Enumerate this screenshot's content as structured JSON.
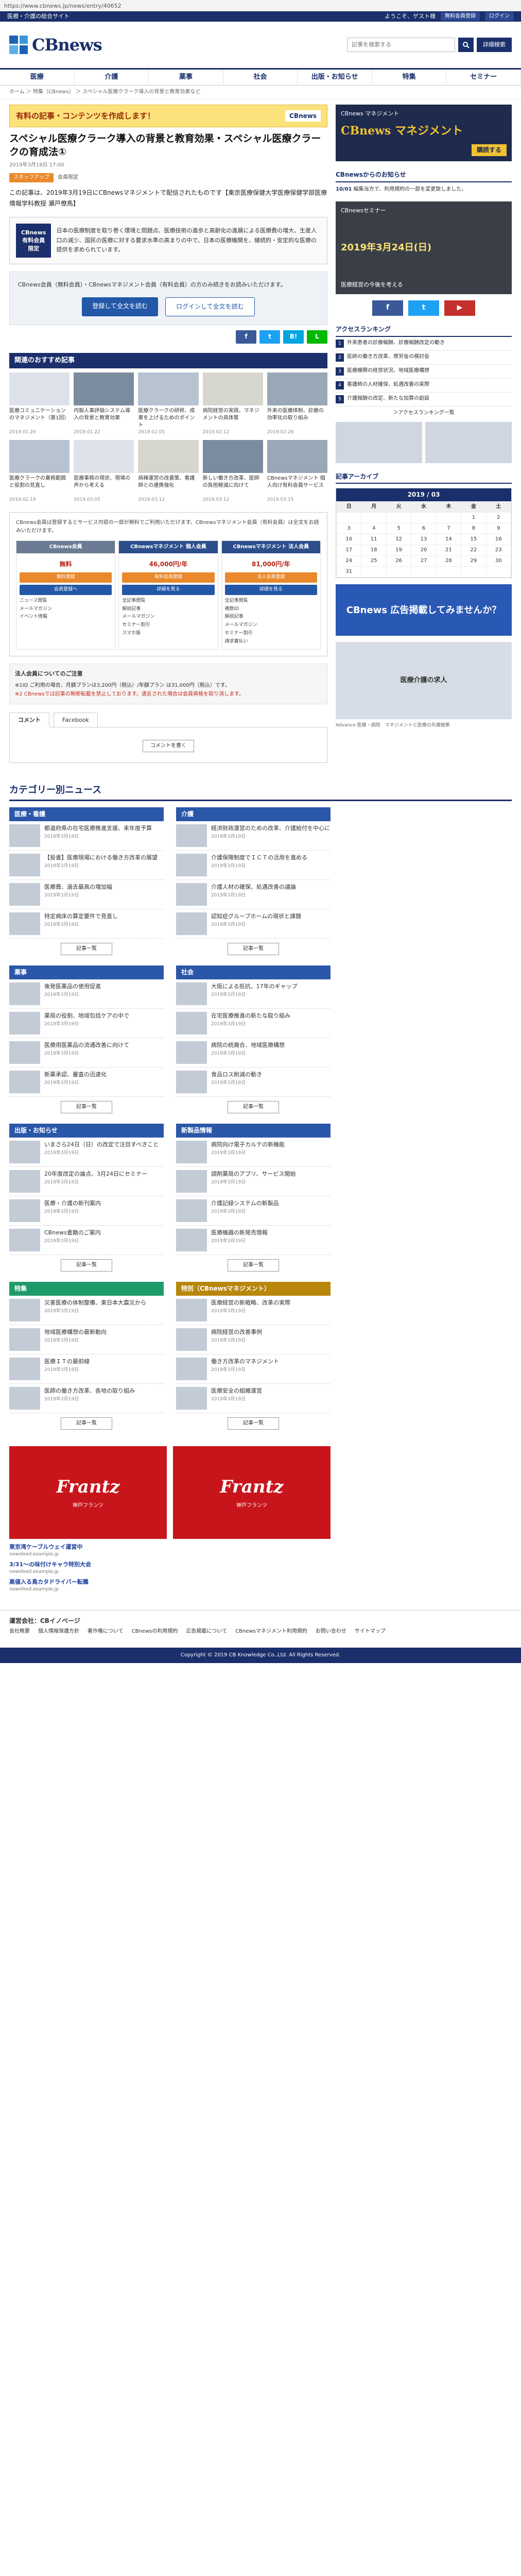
{
  "browser": {
    "url": "https://www.cbnews.jp/news/entry/40652"
  },
  "topbar": {
    "site_tag": "医療・介護の総合サイト",
    "welcome": "ようこそ、ゲスト様",
    "btn_login": "無料会員登録",
    "btn_mypage": "ログイン"
  },
  "header": {
    "logo_text": "CBnews",
    "search_placeholder": "記事を検索する",
    "adv_search": "詳細検索"
  },
  "gnav": [
    "医療",
    "介護",
    "薬事",
    "社会",
    "出版・お知らせ",
    "特集",
    "セミナー"
  ],
  "breadcrumb": "ホーム ＞ 特集（CBnews） ＞ スペシャル医療クラーク導入の背景と教育効果など",
  "premium_banner": {
    "text": "有料の記事・コンテンツを作成します！",
    "brand": "CBnews"
  },
  "article": {
    "title": "スペシャル医療クラーク導入の背景と教育効果・スペシャル医療クラークの育成法①",
    "meta": "2019年3月19日 17:00",
    "tag": "スタッフアップ",
    "tag2": "会員限定",
    "lead": "この記事は、2019年3月19日にCBnewsマネジメントで配信されたものです【東京医療保健大学医療保健学部医療情報学科教授 瀬戸僚馬】"
  },
  "paybox": {
    "badge": "CBnews 有料会員 限定",
    "text": "日本の医療制度を取り巻く環境と問題点、医療技術の進歩と高齢化の進展による医療費の増大、生産人口の減少、国民の医療に対する要求水準の高まりの中で、日本の医療機関を、継続的・安定的な医療の提供を求められています。"
  },
  "loginbox": {
    "text": "CBnews会員（無料会員）・CBnewsマネジメント会員（有料会員）の方のみ続きをお読みいただけます。",
    "btn_register": "登録して全文を読む",
    "btn_login": "ログインして全文を読む"
  },
  "social_share": [
    "f",
    "t",
    "B!",
    "L"
  ],
  "recommend": {
    "title": "関連のおすすめ記事",
    "items": [
      {
        "title": "医療コミュニケーションのマネジメント（第1回）",
        "date": "2019.01.29"
      },
      {
        "title": "内製人事評価システム導入の背景と教育効果",
        "date": "2019.01.22"
      },
      {
        "title": "医療クラークの研修、成果を上げるためのポイント",
        "date": "2019.02.05"
      },
      {
        "title": "病院経営の実践、マネジメントの具体策",
        "date": "2019.02.12"
      },
      {
        "title": "外来の医療体制、診療の効率化の取り組み",
        "date": "2019.02.26"
      },
      {
        "title": "医療クラークの業務範囲と役割の見直し",
        "date": "2019.02.19"
      },
      {
        "title": "医療事務の現状、現場の声から考える",
        "date": "2019.03.05"
      },
      {
        "title": "病棟運営の改善策、看護師との連携強化",
        "date": "2019.03.12"
      },
      {
        "title": "新しい働き方改革、医師の負担軽減に向けて",
        "date": "2019.03.12"
      },
      {
        "title": "CBnewsマネジメント 個人向け有料会員サービス",
        "date": "2019.03.15"
      }
    ]
  },
  "plans": {
    "intro": "CBnews会員は登録するとサービス内容の一部が無料でご利用いただけます。CBnewsマネジメント会員（有料会員）は全文をお読みいただけます。",
    "columns": [
      {
        "name": "CBnews会員",
        "price": "無料",
        "btn1": "無料登録",
        "btn2": "会員登録へ",
        "features": [
          "ニュース閲覧",
          "メールマガジン",
          "イベント情報"
        ]
      },
      {
        "name": "CBnewsマネジメント 個人会員",
        "price": "46,000円/年",
        "btn1": "有料会員登録",
        "btn2": "詳細を見る",
        "features": [
          "全記事閲覧",
          "解説記事",
          "メールマガジン",
          "セミナー割引",
          "スマホ版"
        ]
      },
      {
        "name": "CBnewsマネジメント 法人会員",
        "price": "81,000円/年",
        "btn1": "法人会員登録",
        "btn2": "詳細を見る",
        "features": [
          "全記事閲覧",
          "複数ID",
          "解説記事",
          "メールマガジン",
          "セミナー割引",
          "請求書払い"
        ]
      }
    ]
  },
  "priceinfo": {
    "title": "法人会員についてのご注意",
    "text": "※1ID ご利用の場合、月額プランは3,200円（税込）/年額プラン は31,000円（税込）です。",
    "note": "※2 CBnewsでは記事の無断転載を禁止しております。違反された場合は会員資格を取り消します。"
  },
  "comments": {
    "tab1": "コメント",
    "tab2": "Facebook",
    "button": "コメントを書く"
  },
  "category_heading": "カテゴリー別ニュース",
  "categories": [
    {
      "name": "医療・看護",
      "color": "#2b57a8",
      "items": [
        {
          "t": "都道府県の在宅医療推進支援、来年度予算",
          "d": "2019年3月19日"
        },
        {
          "t": "【投書】医療現場における働き方改革の展望",
          "d": "2019年3月19日"
        },
        {
          "t": "医療費、過去最高の増加幅",
          "d": "2019年3月19日"
        },
        {
          "t": "特定病床の算定要件で見直し",
          "d": "2019年3月19日"
        }
      ]
    },
    {
      "name": "介護",
      "color": "#2b57a8",
      "items": [
        {
          "t": "経済財政運営のための改革、介護給付を中心に",
          "d": "2019年3月19日"
        },
        {
          "t": "介護保険制度でＩＣＴの活用を進める",
          "d": "2019年3月19日"
        },
        {
          "t": "介護人材の確保、処遇改善の議論",
          "d": "2019年3月19日"
        },
        {
          "t": "認知症グループホームの現状と課題",
          "d": "2019年3月19日"
        }
      ]
    },
    {
      "name": "薬事",
      "color": "#2b57a8",
      "items": [
        {
          "t": "後発医薬品の使用促進",
          "d": "2019年3月19日"
        },
        {
          "t": "薬局の役割、地域包括ケアの中で",
          "d": "2019年3月19日"
        },
        {
          "t": "医療用医薬品の流通改善に向けて",
          "d": "2019年3月19日"
        },
        {
          "t": "新薬承認、審査の迅速化",
          "d": "2019年3月19日"
        }
      ]
    },
    {
      "name": "社会",
      "color": "#2b57a8",
      "items": [
        {
          "t": "大阪による抵抗、17年のギャップ",
          "d": "2019年3月19日"
        },
        {
          "t": "在宅医療推進の新たな取り組み",
          "d": "2019年3月19日"
        },
        {
          "t": "病院の統廃合、地域医療構想",
          "d": "2019年3月19日"
        },
        {
          "t": "食品ロス削減の動き",
          "d": "2019年3月19日"
        }
      ]
    },
    {
      "name": "出版・お知らせ",
      "color": "#2b57a8",
      "items": [
        {
          "t": "いまさら24日（日）の改定で注目すべきこと",
          "d": "2019年3月19日"
        },
        {
          "t": "20年度改定の論点、3月24日にセミナー",
          "d": "2019年3月19日"
        },
        {
          "t": "医療・介護の新刊案内",
          "d": "2019年3月19日"
        },
        {
          "t": "CBnews書籍のご案内",
          "d": "2019年3月19日"
        }
      ]
    },
    {
      "name": "新製品情報",
      "color": "#2b57a8",
      "items": [
        {
          "t": "病院向け電子カルテの新機能",
          "d": "2019年3月19日"
        },
        {
          "t": "調剤薬局のアプリ、サービス開始",
          "d": "2019年3月19日"
        },
        {
          "t": "介護記録システムの新製品",
          "d": "2019年3月19日"
        },
        {
          "t": "医療機器の新発売情報",
          "d": "2019年3月19日"
        }
      ]
    },
    {
      "name": "特集",
      "color": "#1f9b6a",
      "items": [
        {
          "t": "災害医療の体制整備、東日本大震災から",
          "d": "2019年3月19日"
        },
        {
          "t": "地域医療構想の最新動向",
          "d": "2019年3月19日"
        },
        {
          "t": "医療ＩＴの最前線",
          "d": "2019年3月19日"
        },
        {
          "t": "医師の働き方改革、各地の取り組み",
          "d": "2019年3月19日"
        }
      ]
    },
    {
      "name": "特別（CBnewsマネジメント）",
      "color": "#b8860b",
      "items": [
        {
          "t": "医療経営の新戦略、改革の実際",
          "d": "2019年3月19日"
        },
        {
          "t": "病院経営の改善事例",
          "d": "2019年3月19日"
        },
        {
          "t": "働き方改革のマネジメント",
          "d": "2019年3月19日"
        },
        {
          "t": "医療安全の組織運営",
          "d": "2019年3月19日"
        }
      ]
    }
  ],
  "category_more": "記事一覧",
  "ads_bottom": [
    {
      "big": "Frantz",
      "small": "神戸フランツ"
    },
    {
      "big": "Frantz",
      "small": "神戸フランツ"
    }
  ],
  "admeta": {
    "label": "広告",
    "links": [
      {
        "title": "東京湾ケーブルウェイ運営中",
        "src": "newsfeed.example.jp"
      },
      {
        "title": "3/31〜の味付けキャラ特別大会",
        "src": "newsfeed.example.jp"
      },
      {
        "title": "高値入る鳥カタドライバー転職",
        "src": "newsfeed.example.jp"
      }
    ]
  },
  "footer": {
    "title": "運営会社：CBイノベージ",
    "links": [
      "会社概要",
      "個人情報保護方針",
      "著作権について",
      "CBnewsの利用規約",
      "広告掲載について",
      "CBnewsマネジメント利用規約",
      "お問い合わせ",
      "サイトマップ"
    ],
    "copyright": "Copyright © 2019 CB Knowledge Co.,Ltd. All Rights Reserved."
  },
  "sidebar": {
    "ad_top": {
      "l1": "CBnews マネジメント",
      "l2": "CBnews マネジメント",
      "l3": "購読する"
    },
    "news_head": "CBnewsからのお知らせ",
    "news": [
      {
        "date": "10/01",
        "text": "編集当方で、利用規約の一部を変更致しました。"
      }
    ],
    "seminar": {
      "title": "CBnewsセミナー",
      "date": "2019年3月24日(日)",
      "text": "医療経営の今後を考える"
    },
    "social": [
      "f",
      "t",
      "▶"
    ],
    "rank_head": "アクセスランキング",
    "ranking": [
      "外来患者の診療報酬、診療報酬改定の動き",
      "医師の働き方改革、厚労省の検討会",
      "医療機関の経営状況、地域医療構想",
      "看護師の人材確保、処遇改善の実際",
      "介護報酬の改定、新たな加算の創設"
    ],
    "rank_more": "＞アクセスランキング一覧",
    "calendar": {
      "title": "記事アーカイブ",
      "month": "2019 / 03",
      "weekdays": [
        "日",
        "月",
        "火",
        "水",
        "木",
        "金",
        "土"
      ],
      "weeks": [
        [
          "",
          "",
          "",
          "",
          "",
          "1",
          "2"
        ],
        [
          "3",
          "4",
          "5",
          "6",
          "7",
          "8",
          "9"
        ],
        [
          "10",
          "11",
          "12",
          "13",
          "14",
          "15",
          "16"
        ],
        [
          "17",
          "18",
          "19",
          "20",
          "21",
          "22",
          "23"
        ],
        [
          "24",
          "25",
          "26",
          "27",
          "28",
          "29",
          "30"
        ],
        [
          "31",
          "",
          "",
          "",
          "",
          "",
          ""
        ]
      ]
    },
    "ad_mid": "CBnews 広告掲載してみませんか？",
    "ad_mid2": "医療介護の求人",
    "note": "Advance 医療・病院　マネジメントと医療の先端施策"
  }
}
